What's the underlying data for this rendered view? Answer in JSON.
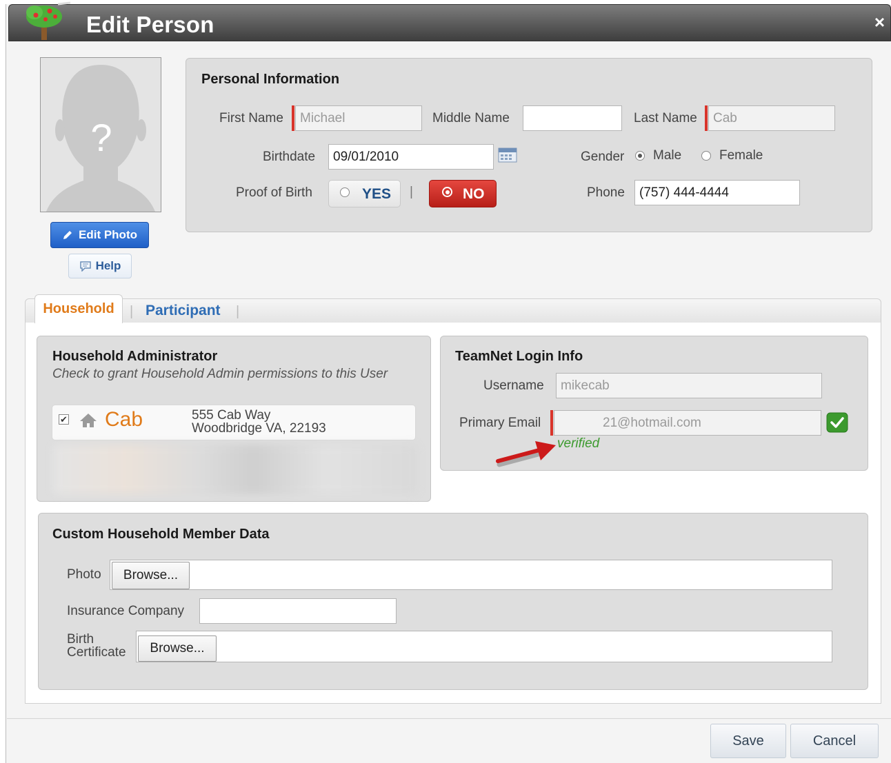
{
  "window": {
    "title": "Edit Person",
    "close_glyph": "×",
    "app_icon": "tree-icon"
  },
  "photo": {
    "placeholder_glyph": "?",
    "edit_label": "Edit Photo",
    "help_label": "Help"
  },
  "personal": {
    "title": "Personal Information",
    "first_name_label": "First Name",
    "first_name": "Michael",
    "middle_name_label": "Middle Name",
    "middle_name": "",
    "last_name_label": "Last Name",
    "last_name": "Cab",
    "birthdate_label": "Birthdate",
    "birthdate": "09/01/2010",
    "gender_label": "Gender",
    "gender_male": "Male",
    "gender_female": "Female",
    "gender_selected": "Male",
    "proof_label": "Proof of Birth",
    "proof_yes": "YES",
    "proof_sep": "|",
    "proof_no": "NO",
    "proof_selected": "NO",
    "phone_label": "Phone",
    "phone": "(757) 444-4444"
  },
  "tabs": [
    {
      "label": "Household",
      "active": true
    },
    {
      "label": "Participant",
      "active": false
    }
  ],
  "household_admin": {
    "title": "Household Administrator",
    "subtitle": "Check to grant Household Admin permissions to this User",
    "household": {
      "name": "Cab",
      "address_line1": "555 Cab Way",
      "address_line2": "Woodbridge VA, 22193",
      "checked": true
    }
  },
  "login": {
    "title": "TeamNet Login Info",
    "username_label": "Username",
    "username": "mikecab",
    "email_label": "Primary Email",
    "email": "21@hotmail.com",
    "verified_text": "verified"
  },
  "custom": {
    "title": "Custom Household Member Data",
    "photo_label": "Photo",
    "browse_label": "Browse...",
    "insurance_label": "Insurance Company",
    "insurance_value": "",
    "birth_cert_label_1": "Birth",
    "birth_cert_label_2": "Certificate"
  },
  "footer": {
    "save_label": "Save",
    "cancel_label": "Cancel"
  },
  "colors": {
    "accent_orange": "#e07b1a",
    "link_blue": "#2f6db5",
    "required_red": "#d9342b",
    "verified_green": "#3c9a2e",
    "no_button_red": "#c9271f"
  }
}
